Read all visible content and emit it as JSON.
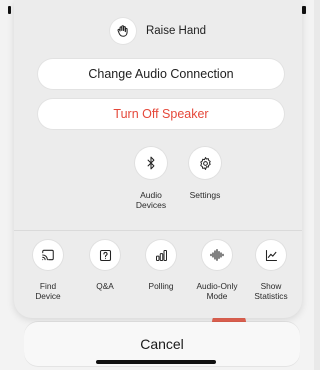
{
  "sheet": {
    "raise_hand": {
      "label": "Raise Hand",
      "icon": "hand-icon"
    },
    "buttons": [
      {
        "label": "Change Audio Connection",
        "color": "#1e1e1e"
      },
      {
        "label": "Turn Off Speaker",
        "color": "#e5483a"
      }
    ],
    "mid_items": [
      {
        "line1": "Audio",
        "line2": "Devices",
        "icon": "bluetooth-icon"
      },
      {
        "line1": "Settings",
        "line2": "",
        "icon": "gear-icon"
      }
    ],
    "bottom_items": [
      {
        "line1": "Find",
        "line2": "Device",
        "icon": "cast-icon"
      },
      {
        "line1": "Q&A",
        "line2": "",
        "icon": "question-icon"
      },
      {
        "line1": "Polling",
        "line2": "",
        "icon": "poll-icon"
      },
      {
        "line1": "Audio-Only",
        "line2": "Mode",
        "icon": "audio-wave-icon"
      },
      {
        "line1": "Show",
        "line2": "Statistics",
        "icon": "statistics-icon"
      }
    ]
  },
  "cancel": {
    "label": "Cancel"
  },
  "colors": {
    "accent_red": "#e5483a",
    "sheet_bg": "#ececec"
  }
}
